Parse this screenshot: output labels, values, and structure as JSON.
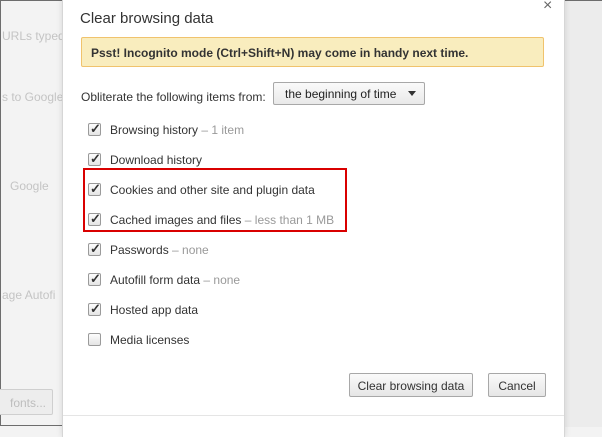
{
  "background": {
    "fragments": [
      "URLs typed",
      "s to Google",
      "Google",
      "age Autofi"
    ],
    "fonts_button": "fonts..."
  },
  "dialog": {
    "title": "Clear browsing data",
    "close_glyph": "×",
    "banner": "Psst! Incognito mode (Ctrl+Shift+N) may come in handy next time.",
    "period_label": "Obliterate the following items from:",
    "period_selected": "the beginning of time",
    "items": [
      {
        "label": "Browsing history",
        "extra": "– 1 item",
        "checked": true
      },
      {
        "label": "Download history",
        "extra": "",
        "checked": true
      },
      {
        "label": "Cookies and other site and plugin data",
        "extra": "",
        "checked": true
      },
      {
        "label": "Cached images and files",
        "extra": "– less than 1 MB",
        "checked": true
      },
      {
        "label": "Passwords",
        "extra": "– none",
        "checked": true
      },
      {
        "label": "Autofill form data",
        "extra": "– none",
        "checked": true
      },
      {
        "label": "Hosted app data",
        "extra": "",
        "checked": true
      },
      {
        "label": "Media licenses",
        "extra": "",
        "checked": false
      }
    ],
    "buttons": {
      "clear": "Clear browsing data",
      "cancel": "Cancel"
    },
    "highlight_color": "#d90000",
    "banner_color": "#f9edbe"
  }
}
